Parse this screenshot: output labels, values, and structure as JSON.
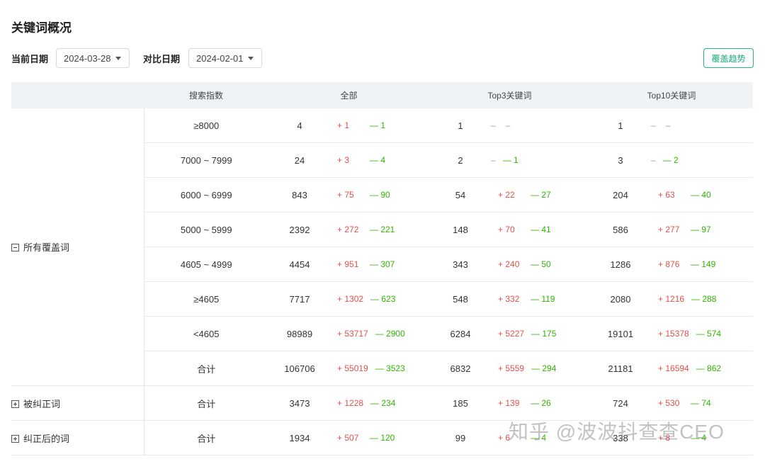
{
  "page": {
    "title": "关键词概况"
  },
  "filters": {
    "current_label": "当前日期",
    "current_value": "2024-03-28",
    "compare_label": "对比日期",
    "compare_value": "2024-02-01"
  },
  "trend_button": "覆盖趋势",
  "table": {
    "headers": [
      "",
      "搜索指数",
      "全部",
      "Top3关键词",
      "Top10关键词"
    ],
    "groups": [
      {
        "label": "所有覆盖词",
        "expanded": true,
        "rows": [
          {
            "range": "≥8000",
            "all": [
              "4",
              "+ 1",
              "— 1"
            ],
            "top3": [
              "1",
              "–",
              "–"
            ],
            "top10": [
              "1",
              "–",
              "–"
            ]
          },
          {
            "range": "7000 ~ 7999",
            "all": [
              "24",
              "+ 3",
              "— 4"
            ],
            "top3": [
              "2",
              "–",
              "— 1"
            ],
            "top10": [
              "3",
              "–",
              "— 2"
            ]
          },
          {
            "range": "6000 ~ 6999",
            "all": [
              "843",
              "+ 75",
              "— 90"
            ],
            "top3": [
              "54",
              "+ 22",
              "— 27"
            ],
            "top10": [
              "204",
              "+ 63",
              "— 40"
            ]
          },
          {
            "range": "5000 ~ 5999",
            "all": [
              "2392",
              "+ 272",
              "— 221"
            ],
            "top3": [
              "148",
              "+ 70",
              "— 41"
            ],
            "top10": [
              "586",
              "+ 277",
              "— 97"
            ]
          },
          {
            "range": "4605 ~ 4999",
            "all": [
              "4454",
              "+ 951",
              "— 307"
            ],
            "top3": [
              "343",
              "+ 240",
              "— 50"
            ],
            "top10": [
              "1286",
              "+ 876",
              "— 149"
            ]
          },
          {
            "range": "≥4605",
            "all": [
              "7717",
              "+ 1302",
              "— 623"
            ],
            "top3": [
              "548",
              "+ 332",
              "— 119"
            ],
            "top10": [
              "2080",
              "+ 1216",
              "— 288"
            ]
          },
          {
            "range": "<4605",
            "all": [
              "98989",
              "+ 53717",
              "— 2900"
            ],
            "top3": [
              "6284",
              "+ 5227",
              "— 175"
            ],
            "top10": [
              "19101",
              "+ 15378",
              "— 574"
            ]
          },
          {
            "range": "合计",
            "all": [
              "106706",
              "+ 55019",
              "— 3523"
            ],
            "top3": [
              "6832",
              "+ 5559",
              "— 294"
            ],
            "top10": [
              "21181",
              "+ 16594",
              "— 862"
            ]
          }
        ]
      },
      {
        "label": "被纠正词",
        "expanded": false,
        "rows": [
          {
            "range": "合计",
            "all": [
              "3473",
              "+ 1228",
              "— 234"
            ],
            "top3": [
              "185",
              "+ 139",
              "— 26"
            ],
            "top10": [
              "724",
              "+ 530",
              "— 74"
            ]
          }
        ]
      },
      {
        "label": "纠正后的词",
        "expanded": false,
        "rows": [
          {
            "range": "合计",
            "all": [
              "1934",
              "+ 507",
              "— 120"
            ],
            "top3": [
              "99",
              "+ 6",
              "— 4"
            ],
            "top10": [
              "338",
              "+ 8",
              "— 4"
            ]
          }
        ]
      }
    ]
  },
  "watermark": "知乎 @波波抖查查CEO",
  "colors": {
    "increase": "#e2504a",
    "decrease": "#2fb500",
    "accent": "#1fa97c",
    "header_bg": "#f0f3f6"
  }
}
